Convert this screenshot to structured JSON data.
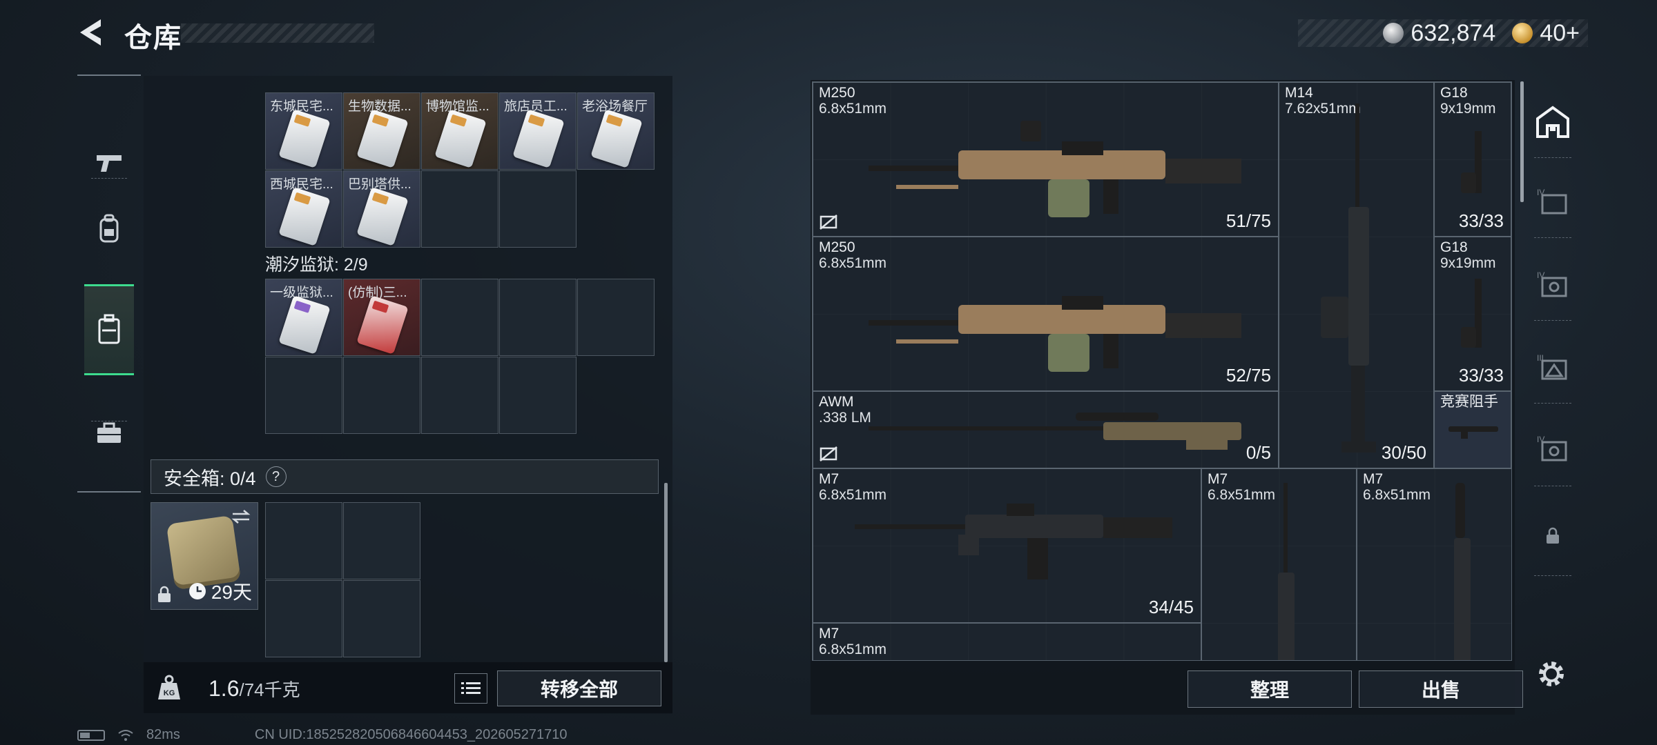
{
  "header": {
    "title": "仓库",
    "silver_amount": "632,874",
    "gold_amount": "40+"
  },
  "left_rail": {
    "items": [
      {
        "icon": "pistol-icon",
        "active": false
      },
      {
        "icon": "backpack-icon",
        "active": false
      },
      {
        "icon": "case-icon",
        "active": true
      },
      {
        "icon": "briefcase-icon",
        "active": false
      }
    ]
  },
  "keycards": {
    "group1_slots": [
      {
        "label": "东城民宅...",
        "bg": "blue"
      },
      {
        "label": "生物数据...",
        "bg": "brown"
      },
      {
        "label": "博物馆监...",
        "bg": "brown"
      },
      {
        "label": "旅店员工...",
        "bg": "blue"
      },
      {
        "label": "老浴场餐厅",
        "bg": "blue"
      },
      {
        "label": "西城民宅...",
        "bg": "blue"
      },
      {
        "label": "巴别塔供...",
        "bg": "blue"
      }
    ],
    "prison_label": "潮汐监狱: 2/9",
    "prison_slots": [
      {
        "label": "一级监狱...",
        "bg": "blue"
      },
      {
        "label": "(仿制)三...",
        "bg": "red"
      }
    ]
  },
  "safe": {
    "label": "安全箱: 0/4",
    "help": "?",
    "days": "29天"
  },
  "weight": {
    "current": "1.6",
    "capacity": "/74千克"
  },
  "buttons": {
    "transfer_all": "转移全部",
    "sort": "整理",
    "sell": "出售"
  },
  "weapons": [
    {
      "name": "M250",
      "caliber": "6.8x51mm",
      "ammo": "51/75"
    },
    {
      "name": "M14",
      "caliber": "7.62x51mm",
      "ammo": "30/50"
    },
    {
      "name": "G18",
      "caliber": "9x19mm",
      "ammo": "33/33"
    },
    {
      "name": "M250",
      "caliber": "6.8x51mm",
      "ammo": "52/75"
    },
    {
      "name": "G18",
      "caliber": "9x19mm",
      "ammo": "33/33"
    },
    {
      "name": "AWM",
      "caliber": ".338 LM",
      "ammo": "0/5"
    },
    {
      "name": "竞赛阻手",
      "caliber": "",
      "ammo": ""
    },
    {
      "name": "M7",
      "caliber": "6.8x51mm",
      "ammo": "34/45"
    },
    {
      "name": "M7",
      "caliber": "6.8x51mm",
      "ammo": ""
    },
    {
      "name": "M7",
      "caliber": "6.8x51mm",
      "ammo": ""
    },
    {
      "name": "M7",
      "caliber": "6.8x51mm",
      "ammo": ""
    }
  ],
  "status": {
    "ping": "82ms",
    "uid": "CN UID:185252820506846604453_202605271710"
  },
  "colors": {
    "accent_green": "#3ddc8e",
    "panel_bg": "#141b22"
  }
}
